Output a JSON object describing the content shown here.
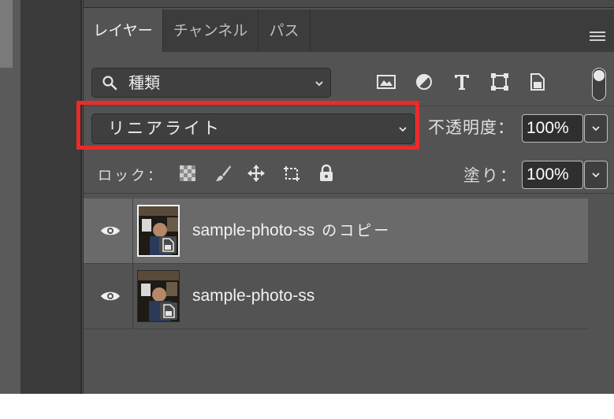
{
  "panel": {
    "tabs": [
      {
        "label": "レイヤー",
        "active": true
      },
      {
        "label": "チャンネル",
        "active": false
      },
      {
        "label": "パス",
        "active": false
      }
    ],
    "menu_icon": "hamburger-menu-icon"
  },
  "filter": {
    "kind_label": "種類",
    "icons": [
      "image-filter-icon",
      "adjustment-filter-icon",
      "type-filter-icon",
      "shape-filter-icon",
      "smart-object-filter-icon"
    ],
    "toggle_on": true
  },
  "blend": {
    "mode": "リニアライト",
    "highlight_color": "#ec2a2a"
  },
  "opacity": {
    "label": "不透明度：",
    "value": "100%"
  },
  "lock": {
    "label": "ロック：",
    "icons": [
      "lock-transparent-pixels-icon",
      "lock-image-pixels-icon",
      "lock-position-icon",
      "lock-artboard-icon",
      "lock-all-icon"
    ]
  },
  "fill": {
    "label": "塗り：",
    "value": "100%"
  },
  "layers": [
    {
      "name_latin": "sample-photo-ss",
      "name_suffix": " のコピー",
      "selected": true,
      "visible": true,
      "smart_object": true
    },
    {
      "name_latin": "sample-photo-ss",
      "name_suffix": "",
      "selected": false,
      "visible": true,
      "smart_object": true
    }
  ],
  "colors": {
    "panel_bg": "#535353",
    "selected_row": "#6a6a6a",
    "highlight": "#ec2a2a"
  }
}
